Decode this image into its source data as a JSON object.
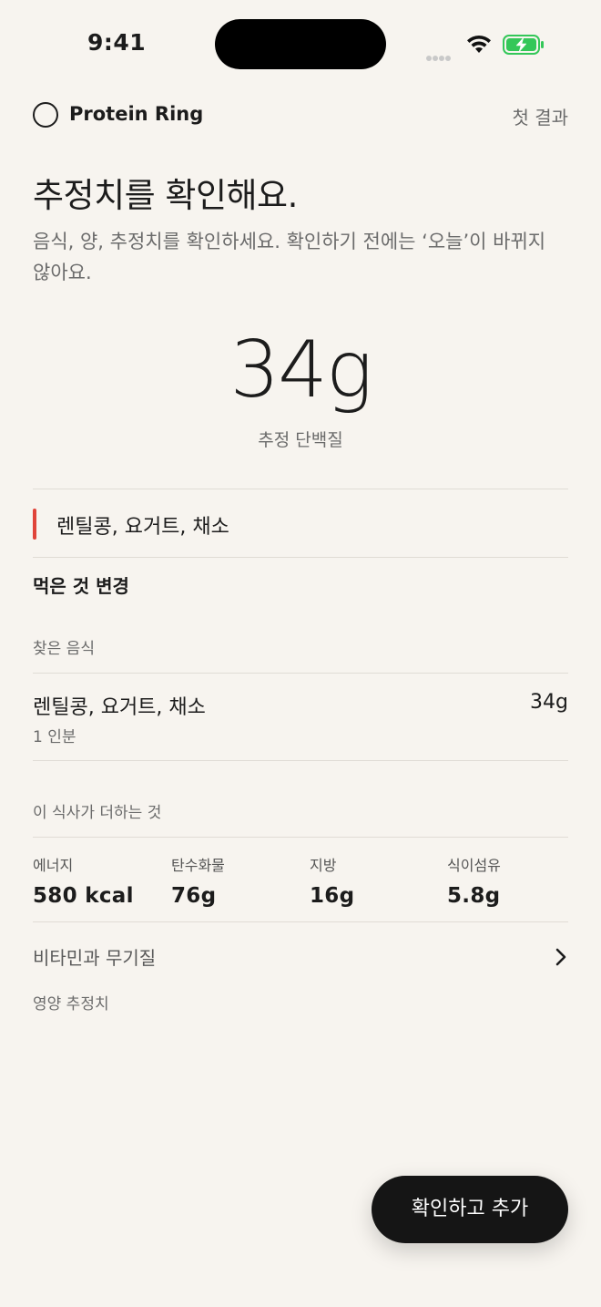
{
  "status_bar": {
    "time": "9:41"
  },
  "header": {
    "brand": "Protein Ring",
    "first_result": "첫 결과"
  },
  "page": {
    "title": "추정치를 확인해요.",
    "subtitle": "음식, 양, 추정치를 확인하세요. 확인하기 전에는 ‘오늘’이 바뀌지 않아요."
  },
  "estimate": {
    "value": "34g",
    "label": "추정 단백질"
  },
  "meal": {
    "name": "렌틸콩, 요거트, 채소",
    "accent_color": "#e0443a"
  },
  "change_label": "먹은 것 변경",
  "found_foods": {
    "label": "찾은 음식",
    "items": [
      {
        "name": "렌틸콩, 요거트, 채소",
        "portion": "1 인분",
        "protein": "34g"
      }
    ]
  },
  "meal_adds": {
    "label": "이 식사가 더하는 것",
    "nutrients": [
      {
        "label": "에너지",
        "value": "580 kcal"
      },
      {
        "label": "탄수화물",
        "value": "76g"
      },
      {
        "label": "지방",
        "value": "16g"
      },
      {
        "label": "식이섬유",
        "value": "5.8g"
      }
    ]
  },
  "vitamins": {
    "label": "비타민과 무기질",
    "icon": "chevron-right-icon"
  },
  "estimate_note": "영양 추정치",
  "confirm_button": {
    "label": "확인하고 추가"
  },
  "colors": {
    "background": "#f7f4ef",
    "button": "#151515",
    "battery": "#34c759"
  }
}
